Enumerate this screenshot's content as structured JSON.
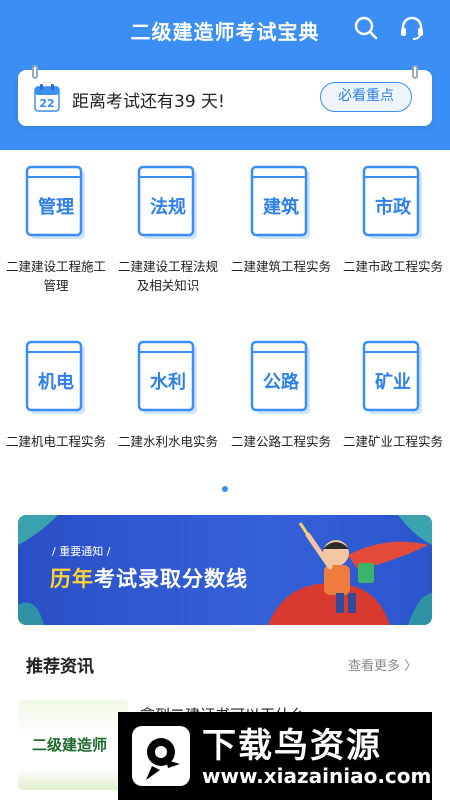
{
  "header": {
    "title": "二级建造师考试宝典",
    "search_icon": "search-icon",
    "service_icon": "headset-icon",
    "bg_color": "#3b8ef3"
  },
  "countdown": {
    "calendar_day": "22",
    "text": "距离考试还有39 天!",
    "button_label": "必看重点"
  },
  "subjects": [
    {
      "label": "管理",
      "name": "二建建设工程施工管理"
    },
    {
      "label": "法规",
      "name": "二建建设工程法规及相关知识"
    },
    {
      "label": "建筑",
      "name": "二建建筑工程实务"
    },
    {
      "label": "市政",
      "name": "二建市政工程实务"
    },
    {
      "label": "机电",
      "name": "二建机电工程实务"
    },
    {
      "label": "水利",
      "name": "二建水利水电实务"
    },
    {
      "label": "公路",
      "name": "二建公路工程实务"
    },
    {
      "label": "矿业",
      "name": "二建矿业工程实务"
    }
  ],
  "banner": {
    "tag": "/ 重要通知 /",
    "title_accent": "历年",
    "title_rest": "考试录取分数线"
  },
  "recommend": {
    "title": "推荐资讯",
    "more_label": "查看更多 〉"
  },
  "news": [
    {
      "thumb_text": "二级建造师",
      "title": "拿到二建证书可以干什么"
    }
  ],
  "watermark": {
    "title": "下载鸟资源",
    "url": "www.xiazainiao.com"
  }
}
